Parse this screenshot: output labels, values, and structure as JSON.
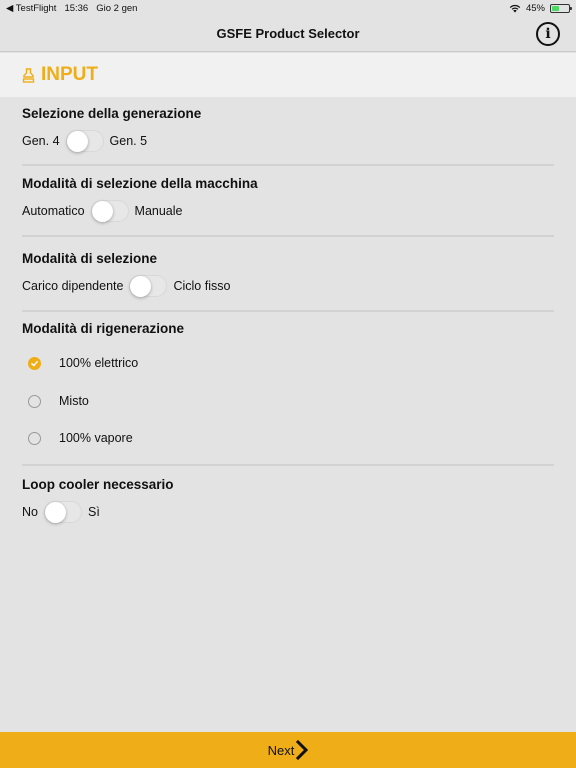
{
  "status_bar": {
    "back_app": "TestFlight",
    "time": "15:36",
    "date": "Gio 2 gen",
    "battery": "45%",
    "battery_level": 0.45
  },
  "nav": {
    "title": "GSFE Product Selector",
    "info_icon": "info-icon"
  },
  "section": {
    "title": "INPUT",
    "icon": "input-icon",
    "accent": "#efae17"
  },
  "generation": {
    "title": "Selezione della generazione",
    "left_label": "Gen. 4",
    "right_label": "Gen. 5",
    "on": false
  },
  "machine_mode": {
    "title": "Modalità di selezione della macchina",
    "left_label": "Automatico",
    "right_label": "Manuale",
    "on": false
  },
  "selection_mode": {
    "title": "Modalità di selezione",
    "left_label": "Carico dipendente",
    "right_label": "Ciclo fisso",
    "on": false
  },
  "regeneration": {
    "title": "Modalità di rigenerazione",
    "options": [
      {
        "label": "100% elettrico",
        "checked": true
      },
      {
        "label": "Misto",
        "checked": false
      },
      {
        "label": "100% vapore",
        "checked": false
      }
    ]
  },
  "loop_cooler": {
    "title": "Loop cooler necessario",
    "left_label": "No",
    "right_label": "Sì",
    "on": false
  },
  "footer": {
    "next_label": "Next"
  }
}
